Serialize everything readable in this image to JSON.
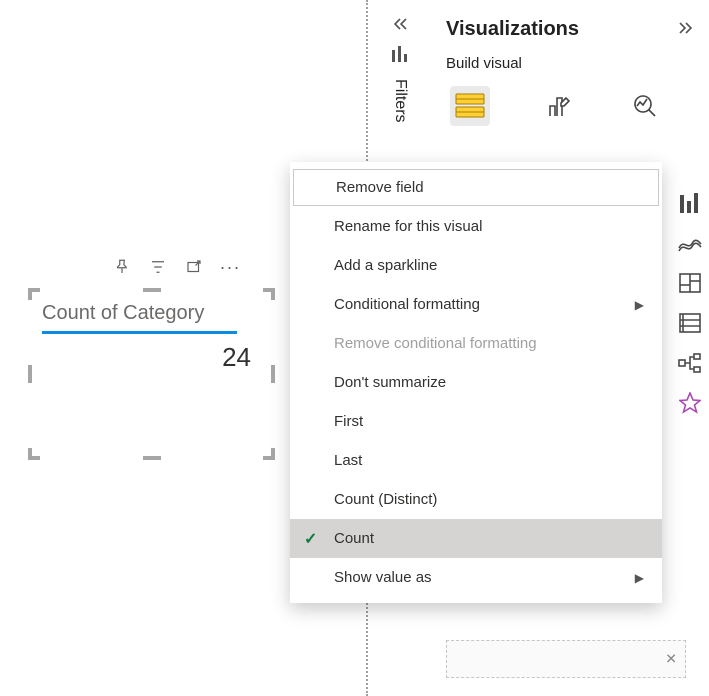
{
  "card": {
    "title": "Count of Category",
    "value": "24"
  },
  "filtersPane": {
    "label": "Filters"
  },
  "visualizations": {
    "title": "Visualizations",
    "subtitle": "Build visual"
  },
  "contextMenu": {
    "items": [
      {
        "label": "Remove field",
        "outlined": true
      },
      {
        "label": "Rename for this visual"
      },
      {
        "label": "Add a sparkline"
      },
      {
        "label": "Conditional formatting",
        "submenu": true
      },
      {
        "label": "Remove conditional formatting",
        "disabled": true
      },
      {
        "label": "Don't summarize"
      },
      {
        "label": "First"
      },
      {
        "label": "Last"
      },
      {
        "label": "Count (Distinct)"
      },
      {
        "label": "Count",
        "selected": true
      },
      {
        "label": "Show value as",
        "submenu": true
      }
    ]
  }
}
